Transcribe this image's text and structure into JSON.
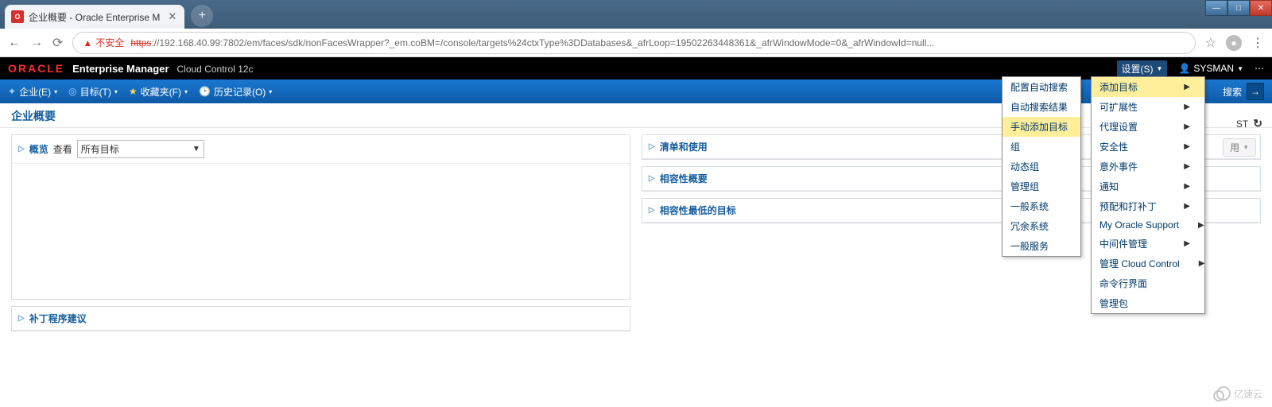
{
  "browser": {
    "tab_title": "企业概要 - Oracle Enterprise M",
    "insecure_label": "不安全",
    "url_protocol": "https",
    "url_rest": "://192.168.40.99:7802/em/faces/sdk/nonFacesWrapper?_em.coBM=/console/targets%24ctxType%3DDatabases&_afrLoop=19502263448361&_afrWindowMode=0&_afrWindowId=null..."
  },
  "em": {
    "oracle": "ORACLE",
    "product": "Enterprise Manager",
    "sub": "Cloud Control 12c",
    "settings": "设置(S)",
    "user": "SYSMAN"
  },
  "nav": {
    "items": [
      "企业(E)",
      "目标(T)",
      "收藏夹(F)",
      "历史记录(O)"
    ],
    "search_label": "搜索"
  },
  "page": {
    "title": "企业概要",
    "cst": "ST"
  },
  "panels": {
    "overview": {
      "title": "概览",
      "view_label": "查看",
      "view_value": "所有目标"
    },
    "patch": {
      "title": "补丁程序建议"
    },
    "inventory": {
      "title": "清单和使用"
    },
    "compat": {
      "title": "相容性概要"
    },
    "lowest": {
      "title": "相容性最低的目标"
    }
  },
  "use_badge": "用",
  "menu_settings": [
    {
      "label": "添加目标",
      "sub": true,
      "hover": true
    },
    {
      "label": "可扩展性",
      "sub": true
    },
    {
      "label": "代理设置",
      "sub": true
    },
    {
      "label": "安全性",
      "sub": true
    },
    {
      "label": "意外事件",
      "sub": true
    },
    {
      "label": "通知",
      "sub": true
    },
    {
      "label": "预配和打补丁",
      "sub": true
    },
    {
      "label": "My Oracle Support",
      "sub": true
    },
    {
      "label": "中间件管理",
      "sub": true
    },
    {
      "label": "管理 Cloud Control",
      "sub": true
    },
    {
      "label": "命令行界面",
      "sub": false
    },
    {
      "label": "管理包",
      "sub": false
    }
  ],
  "menu_add": [
    {
      "label": "配置自动搜索"
    },
    {
      "label": "自动搜索结果"
    },
    {
      "label": "手动添加目标",
      "hover": true
    },
    {
      "label": "组"
    },
    {
      "label": "动态组"
    },
    {
      "label": "管理组"
    },
    {
      "label": "一般系统"
    },
    {
      "label": "冗余系统"
    },
    {
      "label": "一般服务"
    }
  ],
  "watermark": "亿速云"
}
